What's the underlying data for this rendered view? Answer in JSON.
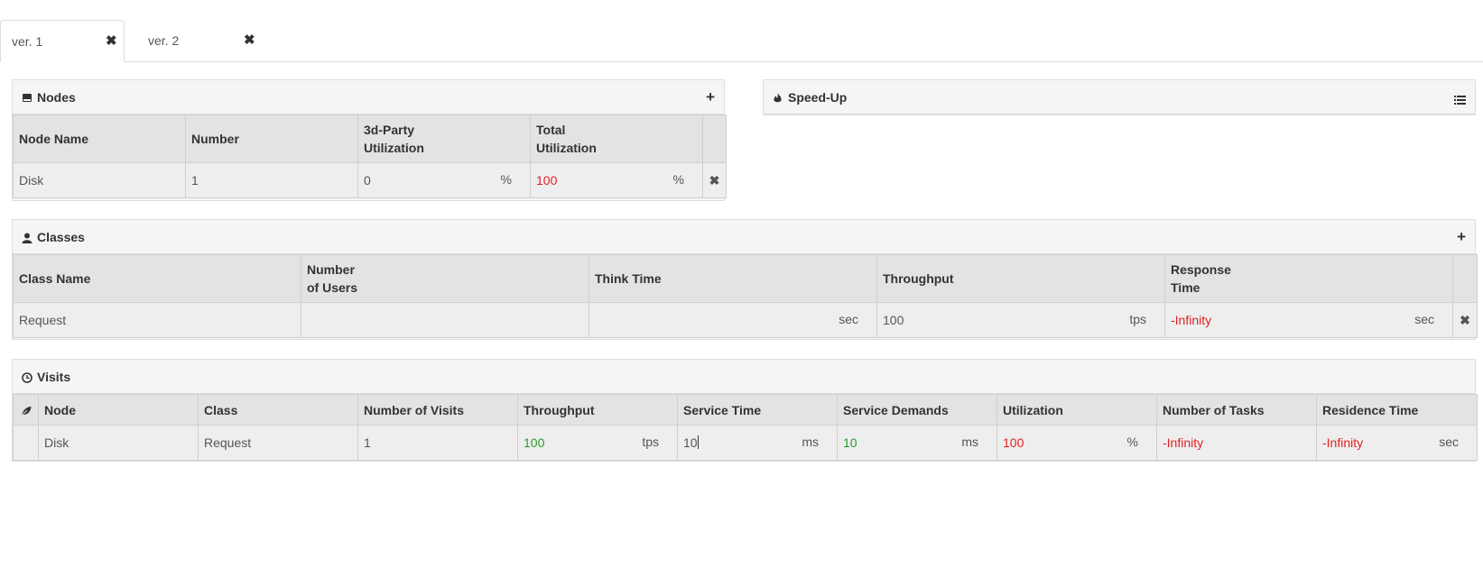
{
  "tabs": [
    {
      "label": "ver. 1",
      "active": true
    },
    {
      "label": "ver. 2",
      "active": false
    }
  ],
  "icons": {
    "close": "close-icon",
    "plus": "plus-icon",
    "hdd": "hdd-icon",
    "fire": "fire-icon",
    "list": "list-icon",
    "user": "user-icon",
    "clock": "clock-icon",
    "leaf": "leaf-icon"
  },
  "colors": {
    "red": "#e02020",
    "green": "#2a9a2a"
  },
  "nodes": {
    "title": "Nodes",
    "headers": [
      "Node Name",
      "Number",
      "3d-Party\nUtilization",
      "Total\nUtilization"
    ],
    "rows": [
      {
        "name": "Disk",
        "number": "1",
        "third_party": "0",
        "third_party_unit": "%",
        "total": "100",
        "total_unit": "%"
      }
    ]
  },
  "speedup": {
    "title": "Speed-Up"
  },
  "classes": {
    "title": "Classes",
    "headers": [
      "Class Name",
      "Number\nof Users",
      "Think Time",
      "Throughput",
      "Response\nTime"
    ],
    "rows": [
      {
        "name": "Request",
        "users": "",
        "think_time": "",
        "think_unit": "sec",
        "throughput": "100",
        "throughput_unit": "tps",
        "response": "-Infinity",
        "response_unit": "sec"
      }
    ]
  },
  "visits": {
    "title": "Visits",
    "headers": [
      "Node",
      "Class",
      "Number of Visits",
      "Throughput",
      "Service Time",
      "Service Demands",
      "Utilization",
      "Number of Tasks",
      "Residence Time"
    ],
    "rows": [
      {
        "node": "Disk",
        "class": "Request",
        "visits": "1",
        "throughput": "100",
        "throughput_unit": "tps",
        "service_time": "10",
        "service_time_unit": "ms",
        "demands": "10",
        "demands_unit": "ms",
        "utilization": "100",
        "utilization_unit": "%",
        "tasks": "-Infinity",
        "residence": "-Infinity",
        "residence_unit": "sec"
      }
    ]
  }
}
